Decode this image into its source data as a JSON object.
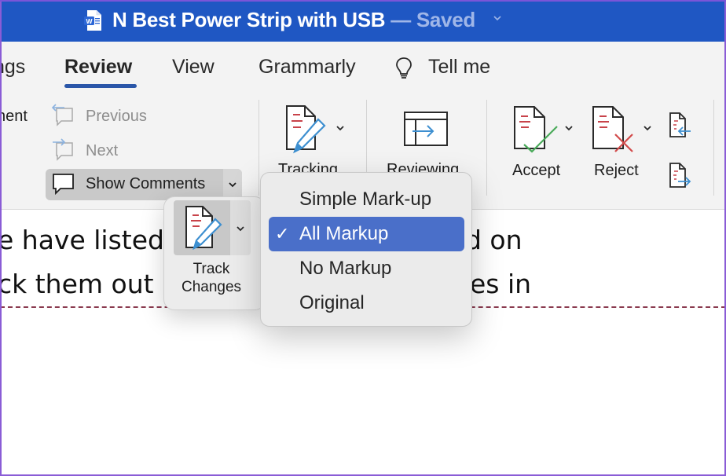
{
  "titlebar": {
    "app_icon": "word-doc-icon",
    "title": "N Best Power Strip with USB",
    "separator": " — ",
    "status": "Saved",
    "bg_color": "#1f57c3"
  },
  "tabs": {
    "items": [
      {
        "label": "ngs",
        "active": false
      },
      {
        "label": "Review",
        "active": true
      },
      {
        "label": "View",
        "active": false
      },
      {
        "label": "Grammarly",
        "active": false
      }
    ],
    "tell_me": {
      "icon": "lightbulb-icon",
      "label": "Tell me"
    },
    "accent_color": "#2a56a8"
  },
  "ribbon": {
    "comment_partial": "nent",
    "previous": {
      "label": "Previous",
      "icon": "previous-comment-icon",
      "enabled": false
    },
    "next": {
      "label": "Next",
      "icon": "next-comment-icon",
      "enabled": false
    },
    "show_comments": {
      "label": "Show Comments",
      "icon": "comment-bubble-icon"
    },
    "tracking": {
      "label": "Tracking",
      "icon": "track-changes-icon"
    },
    "reviewing": {
      "label": "Reviewing",
      "icon": "reviewing-pane-icon"
    },
    "accept": {
      "label": "Accept",
      "icon": "accept-change-icon"
    },
    "reject": {
      "label": "Reject",
      "icon": "reject-change-icon"
    },
    "previous_change": {
      "icon": "previous-change-icon"
    },
    "next_change": {
      "icon": "next-change-icon"
    }
  },
  "track_changes_popover": {
    "label_line1": "Track",
    "label_line2": "Changes",
    "icon": "track-changes-icon"
  },
  "markup_menu": {
    "items": [
      {
        "label": "Simple Mark-up",
        "selected": false
      },
      {
        "label": "All Markup",
        "selected": true
      },
      {
        "label": "No Markup",
        "selected": false
      },
      {
        "label": "Original",
        "selected": false
      }
    ],
    "check_glyph": "✓",
    "selected_color": "#4a6fc9"
  },
  "document": {
    "line1_left": "e have listed",
    "line1_right": "d on",
    "line2_left": "ck them out",
    "line2_right": "es in"
  }
}
